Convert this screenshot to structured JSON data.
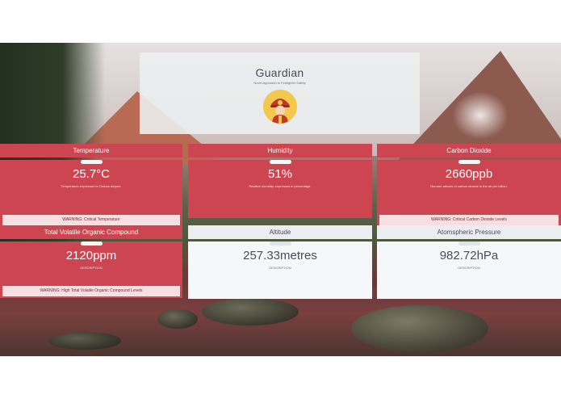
{
  "header": {
    "title": "Guardian",
    "subtitle": "Novel Approach to Firefighter Safety"
  },
  "cards": [
    {
      "title": "Temperature",
      "value": "25.7°C",
      "description": "Temperature expressed in Celsius degree.",
      "warning": "WARNING: Critical Temperature",
      "status": "alert"
    },
    {
      "title": "Humidity",
      "value": "51%",
      "description": "Relative humidity, expressed in percentage.",
      "warning": "",
      "status": "alert"
    },
    {
      "title": "Carbon Dioxide",
      "value": "2660ppb",
      "description": "Number articles of carbon dioxide in the air per billion.",
      "warning": "WARNING: Critical Carbon Dioxide Levels",
      "status": "alert"
    },
    {
      "title": "Total Volatile Organic Compound",
      "value": "2120ppm",
      "description": "DESCRIPTION",
      "warning": "WARNING: High Total Volatile Organic Compound Levels",
      "status": "alert"
    },
    {
      "title": "Altitude",
      "value": "257.33metres",
      "description": "DESCRIPTION",
      "warning": "",
      "status": "normal"
    },
    {
      "title": "Atomspheric Pressure",
      "value": "982.72hPa",
      "description": "DESCRIPTION",
      "warning": "",
      "status": "normal"
    }
  ],
  "colors": {
    "alert": "#cc4550",
    "normal": "#f5f7f9",
    "warning_bg": "#f7dfe1"
  },
  "icons": {
    "avatar": "firefighter-icon"
  }
}
